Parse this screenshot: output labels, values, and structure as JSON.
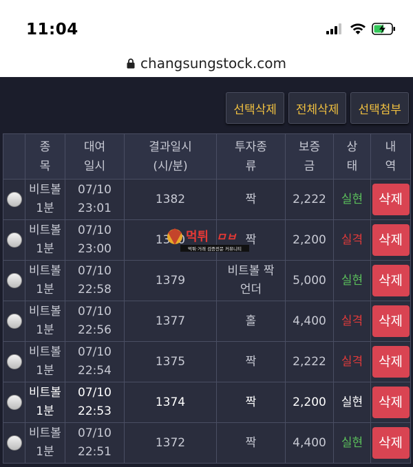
{
  "status_bar": {
    "time": "11:04"
  },
  "browser": {
    "url": "changsungstock.com"
  },
  "actions": {
    "select_delete": "선택삭제",
    "all_delete": "전체삭제",
    "select_attach": "선택첨부"
  },
  "table": {
    "headers": {
      "col_item": [
        "종",
        "목"
      ],
      "col_rent_date": [
        "대여",
        "일시"
      ],
      "col_result_date": [
        "결과일시",
        "(시/분)"
      ],
      "col_bet_type": [
        "투자종",
        "류"
      ],
      "col_deposit": [
        "보증",
        "금"
      ],
      "col_status": [
        "상",
        "태"
      ],
      "col_history": [
        "내",
        "역"
      ]
    },
    "rows": [
      {
        "item": [
          "비트볼",
          "1분"
        ],
        "date": [
          "07/10",
          "23:01"
        ],
        "result": "1382",
        "bet": [
          "짝",
          ""
        ],
        "deposit": "2,222",
        "status": "실현",
        "action": "삭제"
      },
      {
        "item": [
          "비트볼",
          "1분"
        ],
        "date": [
          "07/10",
          "23:00"
        ],
        "result": "1380",
        "bet": [
          "짝",
          ""
        ],
        "deposit": "2,200",
        "status": "실격",
        "action": "삭제"
      },
      {
        "item": [
          "비트볼",
          "1분"
        ],
        "date": [
          "07/10",
          "22:58"
        ],
        "result": "1379",
        "bet": [
          "비트볼 짝",
          "언더"
        ],
        "deposit": "5,000",
        "status": "실현",
        "action": "삭제"
      },
      {
        "item": [
          "비트볼",
          "1분"
        ],
        "date": [
          "07/10",
          "22:56"
        ],
        "result": "1377",
        "bet": [
          "홀",
          ""
        ],
        "deposit": "4,400",
        "status": "실격",
        "action": "삭제"
      },
      {
        "item": [
          "비트볼",
          "1분"
        ],
        "date": [
          "07/10",
          "22:54"
        ],
        "result": "1375",
        "bet": [
          "짝",
          ""
        ],
        "deposit": "2,222",
        "status": "실격",
        "action": "삭제"
      },
      {
        "item": [
          "비트볼",
          "1분"
        ],
        "date": [
          "07/10",
          "22:53"
        ],
        "result": "1374",
        "bet": [
          "짝",
          ""
        ],
        "deposit": "2,200",
        "status": "실현",
        "action": "삭제"
      },
      {
        "item": [
          "비트볼",
          "1분"
        ],
        "date": [
          "07/10",
          "22:51"
        ],
        "result": "1372",
        "bet": [
          "짝",
          ""
        ],
        "deposit": "4,400",
        "status": "실현",
        "action": "삭제"
      }
    ]
  },
  "watermark": {
    "title": "먹튀",
    "sub": "먹튀·거래 검증전문 커뮤니티"
  },
  "colors": {
    "win": "#5bbf5b",
    "lose": "#e03a3a",
    "button_text": "#f0c040",
    "delete_bg": "#d94452"
  }
}
